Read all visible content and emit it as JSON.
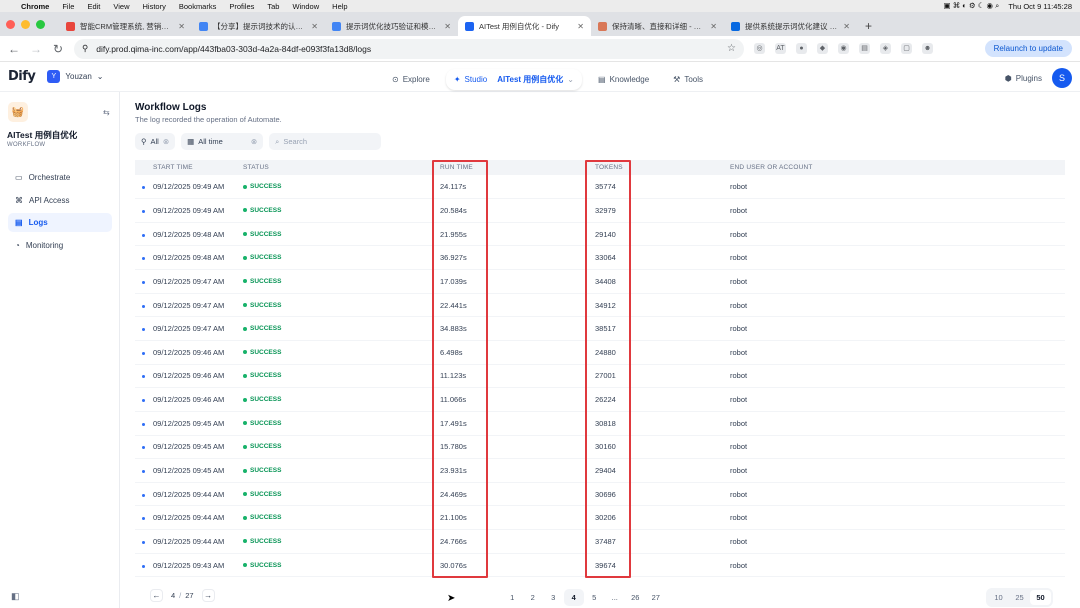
{
  "mac_menu": {
    "apple": "",
    "app": "Chrome",
    "items": [
      "File",
      "Edit",
      "View",
      "History",
      "Bookmarks",
      "Profiles",
      "Tab",
      "Window",
      "Help"
    ],
    "clock": "Thu Oct 9  11:45:28"
  },
  "browser": {
    "tabs": [
      {
        "title": "智能CRM管理系统, 营销自动化",
        "color": "#e8453c"
      },
      {
        "title": "【分享】提示词技术的认知迭代",
        "color": "#4285f4"
      },
      {
        "title": "提示词优化技巧验证和模型差异",
        "color": "#4285f4"
      },
      {
        "title": "AITest 用例自优化 - Dify",
        "color": "#1c64f2",
        "active": true
      },
      {
        "title": "保持清晰、直接和详细 - Claude",
        "color": "#d97757"
      },
      {
        "title": "提供系统提示词优化建议 - Me",
        "color": "#0668e1"
      }
    ],
    "url": "dify.prod.qima-inc.com/app/443fba03-303d-4a2a-84df-e093f3fa13d8/logs",
    "relaunch": "Relaunch to update",
    "ext_icons": [
      "AT"
    ]
  },
  "app": {
    "logo": "Dify",
    "workspace_initial": "Y",
    "workspace": "Youzan",
    "nav": {
      "explore": "Explore",
      "studio": "Studio",
      "app_name": "AITest 用例自优化",
      "knowledge": "Knowledge",
      "tools": "Tools"
    },
    "plugins": "Plugins",
    "user_initial": "S"
  },
  "sidebar": {
    "app_name": "AITest 用例自优化",
    "app_type": "WORKFLOW",
    "items": [
      {
        "label": "Orchestrate"
      },
      {
        "label": "API Access"
      },
      {
        "label": "Logs",
        "active": true
      },
      {
        "label": "Monitoring"
      }
    ]
  },
  "page": {
    "title": "Workflow Logs",
    "description": "The log recorded the operation of Automate.",
    "filter_status": "All",
    "filter_time": "All time",
    "search_placeholder": "Search"
  },
  "table": {
    "columns": [
      "START TIME",
      "STATUS",
      "RUN TIME",
      "TOKENS",
      "END USER OR ACCOUNT"
    ],
    "rows": [
      {
        "start": "09/12/2025 09:49 AM",
        "status": "SUCCESS",
        "run": "24.117s",
        "tokens": "35774",
        "user": "robot"
      },
      {
        "start": "09/12/2025 09:49 AM",
        "status": "SUCCESS",
        "run": "20.584s",
        "tokens": "32979",
        "user": "robot"
      },
      {
        "start": "09/12/2025 09:48 AM",
        "status": "SUCCESS",
        "run": "21.955s",
        "tokens": "29140",
        "user": "robot"
      },
      {
        "start": "09/12/2025 09:48 AM",
        "status": "SUCCESS",
        "run": "36.927s",
        "tokens": "33064",
        "user": "robot"
      },
      {
        "start": "09/12/2025 09:47 AM",
        "status": "SUCCESS",
        "run": "17.039s",
        "tokens": "34408",
        "user": "robot"
      },
      {
        "start": "09/12/2025 09:47 AM",
        "status": "SUCCESS",
        "run": "22.441s",
        "tokens": "34912",
        "user": "robot"
      },
      {
        "start": "09/12/2025 09:47 AM",
        "status": "SUCCESS",
        "run": "34.883s",
        "tokens": "38517",
        "user": "robot"
      },
      {
        "start": "09/12/2025 09:46 AM",
        "status": "SUCCESS",
        "run": "6.498s",
        "tokens": "24880",
        "user": "robot"
      },
      {
        "start": "09/12/2025 09:46 AM",
        "status": "SUCCESS",
        "run": "11.123s",
        "tokens": "27001",
        "user": "robot"
      },
      {
        "start": "09/12/2025 09:46 AM",
        "status": "SUCCESS",
        "run": "11.066s",
        "tokens": "26224",
        "user": "robot"
      },
      {
        "start": "09/12/2025 09:45 AM",
        "status": "SUCCESS",
        "run": "17.491s",
        "tokens": "30818",
        "user": "robot"
      },
      {
        "start": "09/12/2025 09:45 AM",
        "status": "SUCCESS",
        "run": "15.780s",
        "tokens": "30160",
        "user": "robot"
      },
      {
        "start": "09/12/2025 09:45 AM",
        "status": "SUCCESS",
        "run": "23.931s",
        "tokens": "29404",
        "user": "robot"
      },
      {
        "start": "09/12/2025 09:44 AM",
        "status": "SUCCESS",
        "run": "24.469s",
        "tokens": "30696",
        "user": "robot"
      },
      {
        "start": "09/12/2025 09:44 AM",
        "status": "SUCCESS",
        "run": "21.100s",
        "tokens": "30206",
        "user": "robot"
      },
      {
        "start": "09/12/2025 09:44 AM",
        "status": "SUCCESS",
        "run": "24.766s",
        "tokens": "37487",
        "user": "robot"
      },
      {
        "start": "09/12/2025 09:43 AM",
        "status": "SUCCESS",
        "run": "30.076s",
        "tokens": "39674",
        "user": "robot"
      }
    ]
  },
  "pagination": {
    "current": "4",
    "total": "27",
    "pages": [
      "1",
      "2",
      "3",
      "4",
      "5",
      "...",
      "26",
      "27"
    ],
    "active_page": "4",
    "page_sizes": [
      "10",
      "25",
      "50"
    ],
    "active_size": "50"
  },
  "colors": {
    "accent": "#155aef",
    "success": "#079455",
    "highlight": "#e0393e"
  }
}
